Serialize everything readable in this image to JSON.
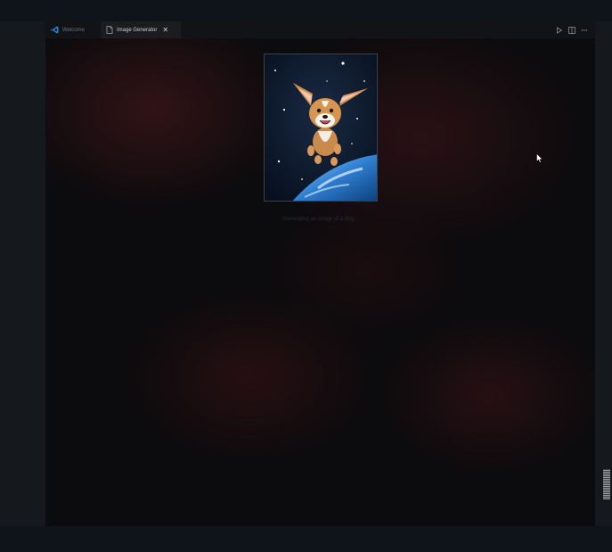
{
  "tabs": [
    {
      "label": "Welcome",
      "icon": "vscode-logo-icon",
      "active": false
    },
    {
      "label": "Image Generator",
      "icon": "file-icon",
      "active": true
    }
  ],
  "tab_actions": [
    "run-icon",
    "split-editor-icon",
    "more-actions-icon"
  ],
  "main": {
    "image_alt": "Generated image: dog floating in space above Earth",
    "caption": "Generating an image of a dog..."
  },
  "colors": {
    "background": "#0b0c0e",
    "accent": "#3b82f6",
    "tab_active_bg": "#1a1c20"
  }
}
